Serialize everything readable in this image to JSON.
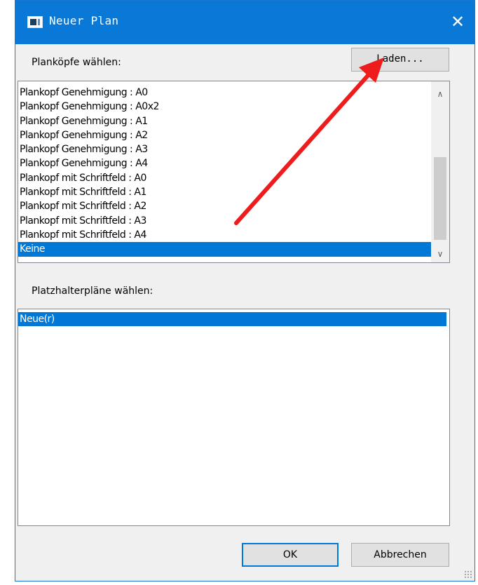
{
  "window": {
    "title": "Neuer Plan",
    "close_glyph": "✕",
    "icon": "app-window-icon"
  },
  "plankoepfe": {
    "label": "Planköpfe wählen:",
    "load_button": "Laden...",
    "items": [
      {
        "label": "Plankopf Genehmigung : A0",
        "selected": false
      },
      {
        "label": "Plankopf Genehmigung : A0x2",
        "selected": false
      },
      {
        "label": "Plankopf Genehmigung : A1",
        "selected": false
      },
      {
        "label": "Plankopf Genehmigung : A2",
        "selected": false
      },
      {
        "label": "Plankopf Genehmigung : A3",
        "selected": false
      },
      {
        "label": "Plankopf Genehmigung : A4",
        "selected": false
      },
      {
        "label": "Plankopf mit Schriftfeld : A0",
        "selected": false
      },
      {
        "label": "Plankopf mit Schriftfeld : A1",
        "selected": false
      },
      {
        "label": "Plankopf mit Schriftfeld : A2",
        "selected": false
      },
      {
        "label": "Plankopf mit Schriftfeld : A3",
        "selected": false
      },
      {
        "label": "Plankopf mit Schriftfeld : A4",
        "selected": false
      },
      {
        "label": "Keine",
        "selected": true
      }
    ]
  },
  "platzhalter": {
    "label": "Platzhalterpläne wählen:",
    "items": [
      {
        "label": "Neue(r)",
        "selected": true
      }
    ]
  },
  "buttons": {
    "ok": "OK",
    "cancel": "Abbrechen"
  },
  "colors": {
    "titlebar": "#0a78d7",
    "selection": "#0078d7",
    "annotation_arrow": "#ee1c1c"
  }
}
